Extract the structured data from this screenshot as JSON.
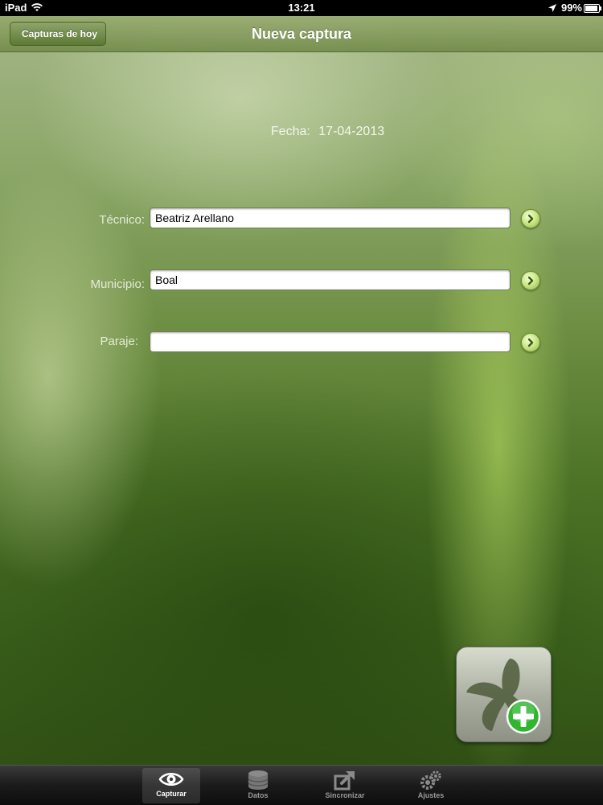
{
  "status_bar": {
    "device": "iPad",
    "time": "13:21",
    "battery": "99%",
    "battery_level": 0.99
  },
  "nav": {
    "back_label": "Capturas de hoy",
    "title": "Nueva captura"
  },
  "fecha": {
    "label": "Fecha:",
    "value": "17-04-2013"
  },
  "form": {
    "tecnico": {
      "label": "Técnico:",
      "value": "Beatriz Arellano"
    },
    "municipio": {
      "label": "Municipio:",
      "value": "Boal"
    },
    "paraje": {
      "label": "Paraje:",
      "value": ""
    }
  },
  "tabs": [
    {
      "label": "Capturar",
      "icon": "eye-icon",
      "selected": true
    },
    {
      "label": "Datos",
      "icon": "database-icon",
      "selected": false
    },
    {
      "label": "Sincronizar",
      "icon": "sync-arrow-icon",
      "selected": false
    },
    {
      "label": "Ajustes",
      "icon": "gears-icon",
      "selected": false
    }
  ],
  "colors": {
    "accent_green": "#cde98a",
    "add_plus_green": "#2fb52f"
  }
}
